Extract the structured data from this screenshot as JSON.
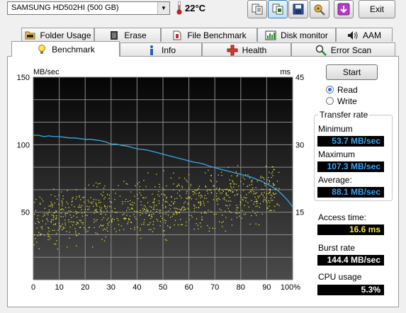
{
  "toolbar": {
    "drive": "SAMSUNG HD502HI (500 GB)",
    "temperature": "22°C",
    "exit_label": "Exit",
    "buttons": [
      "copy-text-icon",
      "copy-screenshot-icon",
      "save-icon",
      "options-icon",
      "down-arrow-icon"
    ]
  },
  "tabs_back": [
    {
      "label": "Folder Usage",
      "icon": "folder-icon"
    },
    {
      "label": "Erase",
      "icon": "erase-icon"
    },
    {
      "label": "File Benchmark",
      "icon": "file-benchmark-icon"
    },
    {
      "label": "Disk monitor",
      "icon": "disk-monitor-icon"
    },
    {
      "label": "AAM",
      "icon": "speaker-icon"
    }
  ],
  "tabs_front": [
    {
      "label": "Benchmark",
      "icon": "lightbulb-icon",
      "selected": true
    },
    {
      "label": "Info",
      "icon": "info-icon",
      "selected": false
    },
    {
      "label": "Health",
      "icon": "health-cross-icon",
      "selected": false
    },
    {
      "label": "Error Scan",
      "icon": "magnifier-icon",
      "selected": false
    }
  ],
  "controls": {
    "start_label": "Start",
    "read_label": "Read",
    "write_label": "Write",
    "mode_selected": "Read"
  },
  "results": {
    "transfer_rate_title": "Transfer rate",
    "minimum_label": "Minimum",
    "minimum_value": "53.7 MB/sec",
    "maximum_label": "Maximum",
    "maximum_value": "107.3 MB/sec",
    "average_label": "Average:",
    "average_value": "88.1 MB/sec",
    "access_label": "Access time:",
    "access_value": "16.6 ms",
    "burst_label": "Burst rate",
    "burst_value": "144.4 MB/sec",
    "cpu_label": "CPU usage",
    "cpu_value": "5.3%"
  },
  "colors": {
    "transfer_line": "#3aa8e8",
    "access_points": "#e8e23a",
    "chart_bg_top": "#050505",
    "chart_bg_bottom": "#4a4a4a",
    "grid": "#8c8c8c"
  },
  "chart_data": {
    "type": "line",
    "ylabel": "MB/sec",
    "y2label": "ms",
    "xlim": [
      0,
      100
    ],
    "ylim": [
      0,
      150
    ],
    "y2lim": [
      0,
      45
    ],
    "x_ticks": [
      "0",
      "10",
      "20",
      "30",
      "40",
      "50",
      "60",
      "70",
      "80",
      "90",
      "100%"
    ],
    "y_ticks": [
      "150",
      "100",
      "50"
    ],
    "y2_ticks": [
      "45",
      "30",
      "15"
    ],
    "grid": true,
    "series": [
      {
        "style": "line",
        "axis": "left",
        "x": [
          0,
          2,
          4,
          6,
          8,
          10,
          12,
          14,
          16,
          18,
          20,
          22,
          24,
          26,
          28,
          30,
          32,
          34,
          36,
          38,
          40,
          42,
          44,
          46,
          48,
          50,
          52,
          54,
          56,
          58,
          60,
          62,
          64,
          66,
          68,
          70,
          72,
          74,
          76,
          78,
          80,
          82,
          84,
          86,
          88,
          90,
          92,
          94,
          96,
          98,
          100
        ],
        "values": [
          107,
          107,
          106,
          106.5,
          106,
          106,
          105.5,
          105,
          105,
          104.5,
          104,
          104,
          103.5,
          103,
          102,
          100.5,
          100.5,
          99.5,
          99,
          98,
          97,
          96.5,
          96,
          95,
          94,
          93,
          92,
          91,
          90,
          89,
          88,
          87,
          86.5,
          85.5,
          84,
          83,
          82,
          81,
          80,
          79,
          78,
          77,
          76,
          74.5,
          73,
          71,
          69,
          66.5,
          63,
          59,
          54
        ]
      },
      {
        "style": "scatter",
        "axis": "right",
        "x_range": [
          0,
          95
        ],
        "y_center_start": 13,
        "y_center_end": 20,
        "y_spread": 6,
        "count": 900
      }
    ]
  }
}
